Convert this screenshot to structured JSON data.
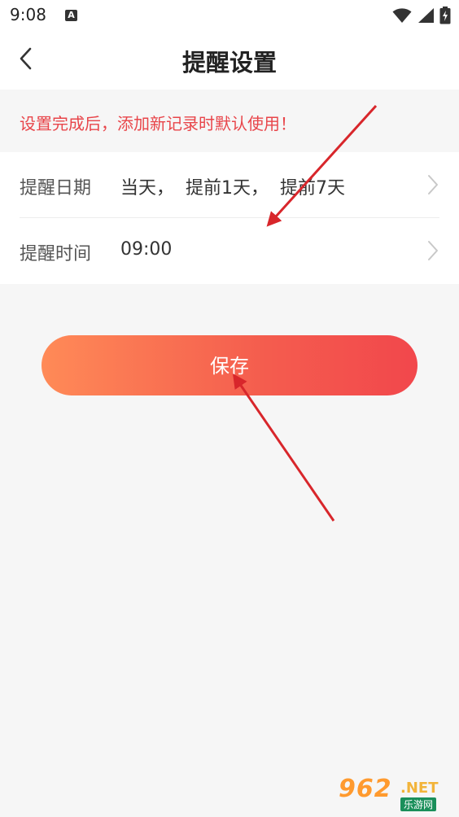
{
  "status_bar": {
    "time": "9:08",
    "a_label": "A",
    "icons": [
      "wifi-icon",
      "signal-icon",
      "battery-icon"
    ]
  },
  "header": {
    "title": "提醒设置"
  },
  "notice": {
    "text": "设置完成后，添加新记录时默认使用！",
    "color": "#e8454a"
  },
  "settings": {
    "rows": [
      {
        "label": "提醒日期",
        "value": "当天，  提前1天，  提前7天"
      },
      {
        "label": "提醒时间",
        "value": "09:00"
      }
    ]
  },
  "save": {
    "label": "保存",
    "gradient_start": "#ff8a57",
    "gradient_end": "#f2474c"
  },
  "watermark": {
    "main": "962",
    "suffix": ".NET",
    "sub": "乐游网"
  }
}
